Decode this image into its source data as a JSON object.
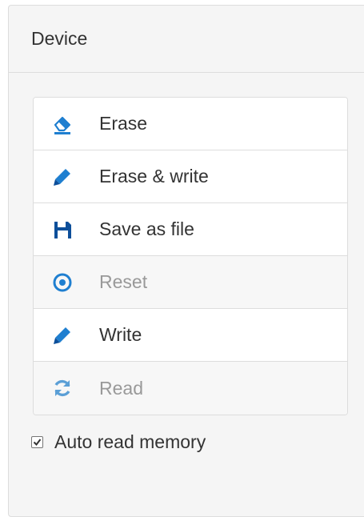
{
  "panel": {
    "title": "Device"
  },
  "actions": [
    {
      "label": "Erase",
      "icon": "eraser-icon",
      "disabled": false
    },
    {
      "label": "Erase & write",
      "icon": "pencil-icon",
      "disabled": false
    },
    {
      "label": "Save as file",
      "icon": "floppy-disk-icon",
      "disabled": false
    },
    {
      "label": "Reset",
      "icon": "record-icon",
      "disabled": true
    },
    {
      "label": "Write",
      "icon": "pencil-icon",
      "disabled": false
    },
    {
      "label": "Read",
      "icon": "refresh-icon",
      "disabled": true
    }
  ],
  "auto_read": {
    "label": "Auto read memory",
    "checked": true
  },
  "colors": {
    "icon_blue": "#1f7fd0",
    "icon_dark_blue": "#0d4f9a",
    "icon_disabled": "#5b9fd6",
    "text": "#333333",
    "text_disabled": "#999999"
  }
}
